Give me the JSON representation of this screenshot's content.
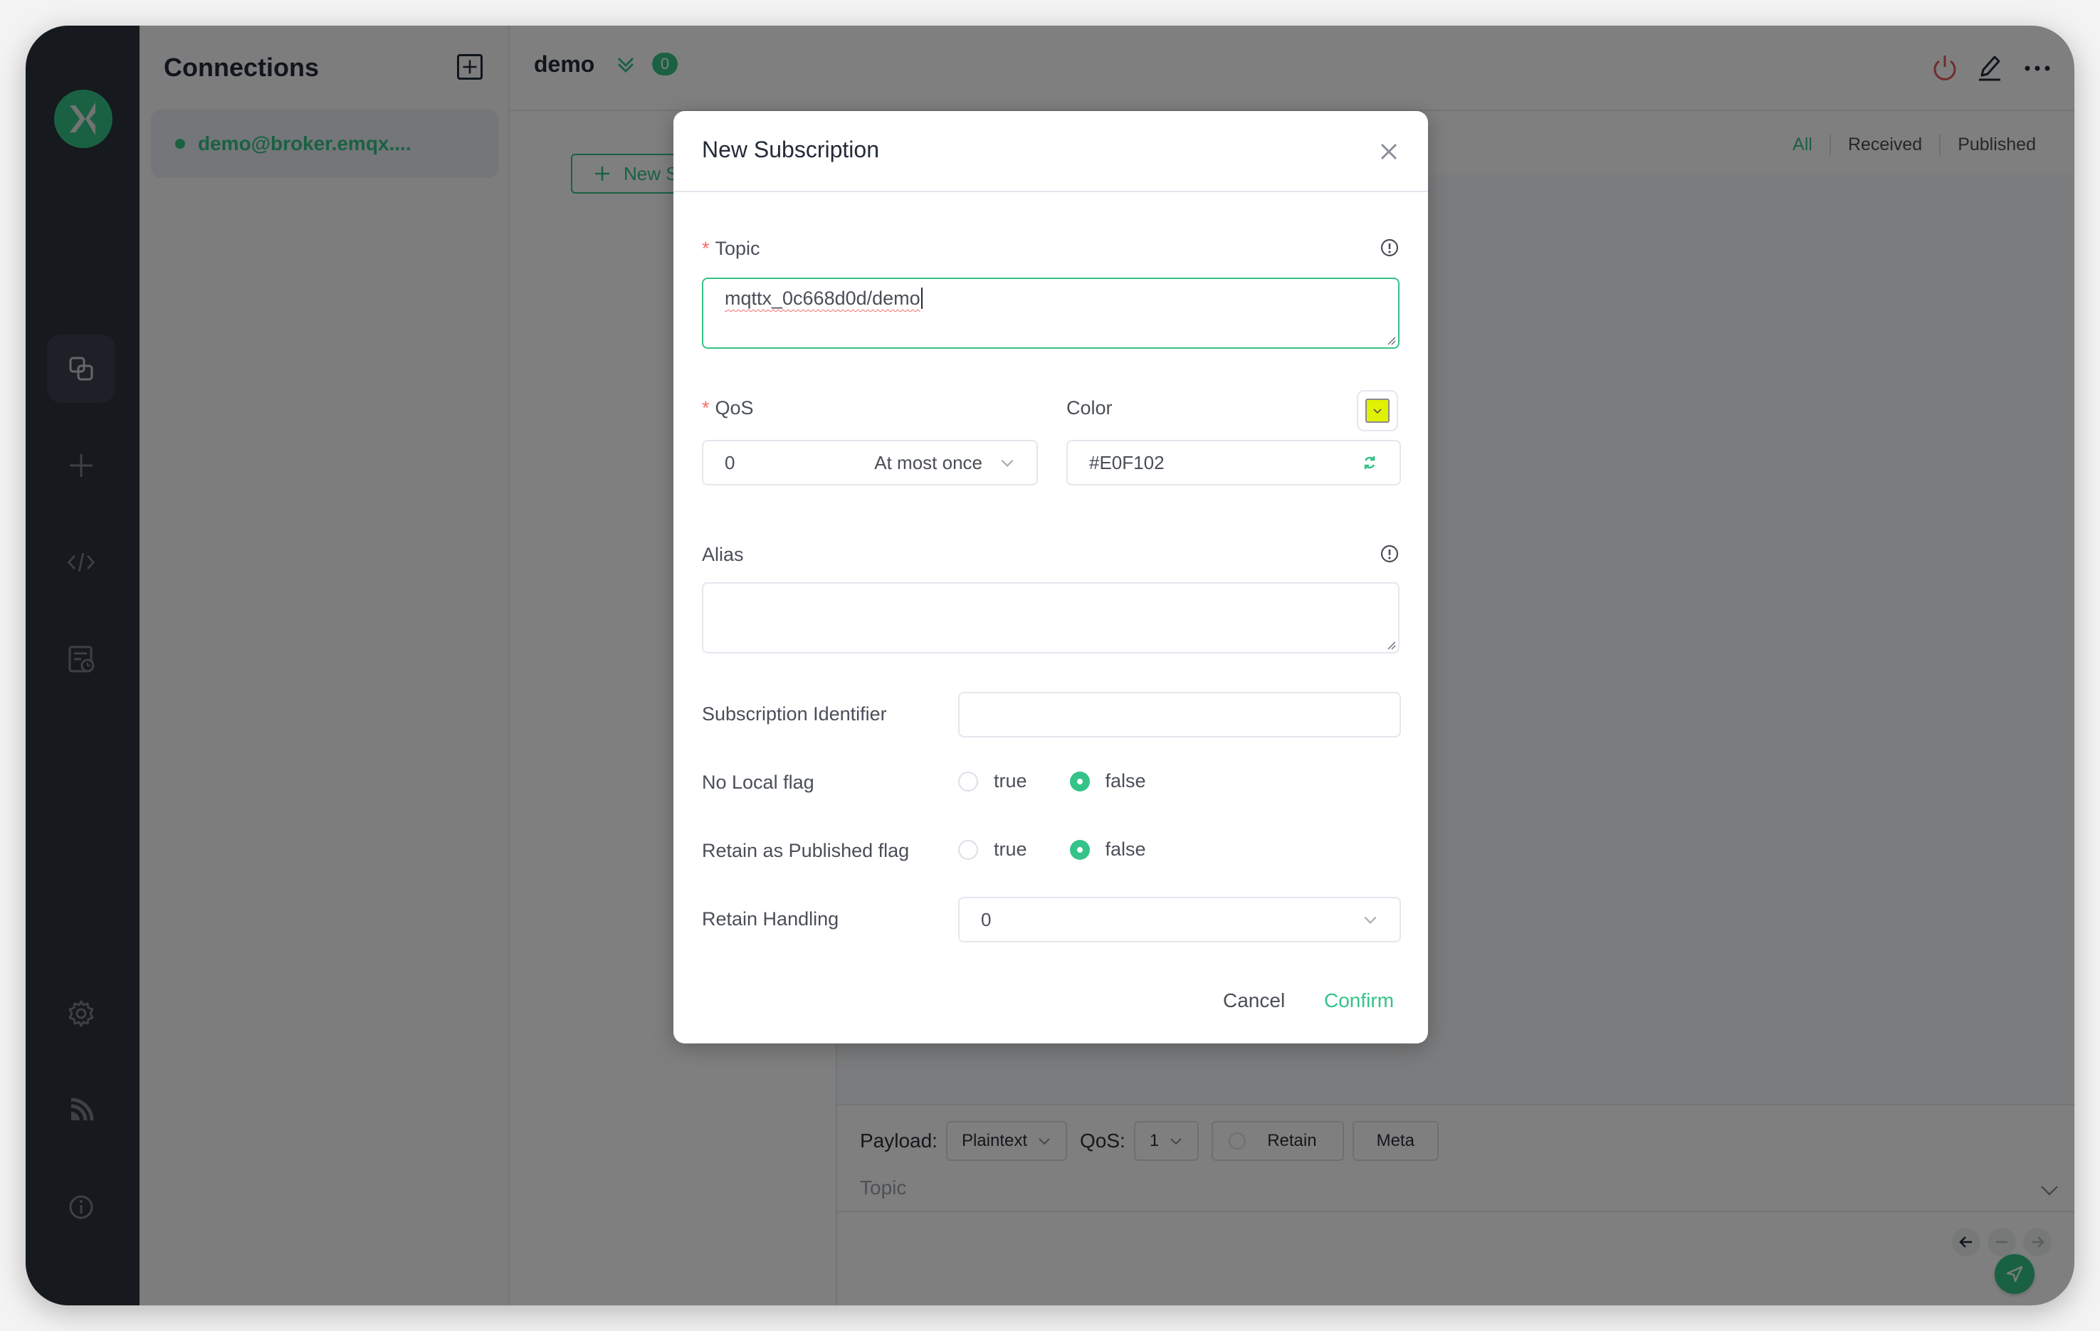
{
  "sidebar": {
    "items": [
      {
        "name": "connections",
        "icon": "connections-icon",
        "active": true
      },
      {
        "name": "new-connection",
        "icon": "plus-icon"
      },
      {
        "name": "script",
        "icon": "code-icon"
      },
      {
        "name": "log",
        "icon": "log-icon"
      },
      {
        "name": "settings",
        "icon": "gear-icon"
      },
      {
        "name": "feed",
        "icon": "rss-icon"
      },
      {
        "name": "about",
        "icon": "info-icon"
      }
    ]
  },
  "connections": {
    "title": "Connections",
    "items": [
      {
        "label": "demo@broker.emqx....",
        "status": "connected"
      }
    ]
  },
  "main": {
    "title": "demo",
    "unread_count": "0",
    "new_subscription_label": "New Subscription",
    "filters": [
      "All",
      "Received",
      "Published"
    ],
    "active_filter": "All"
  },
  "publish": {
    "payload_label": "Payload:",
    "payload_format": "Plaintext",
    "qos_label": "QoS:",
    "qos_value": "1",
    "retain_label": "Retain",
    "meta_label": "Meta",
    "topic_placeholder": "Topic"
  },
  "modal": {
    "title": "New Subscription",
    "topic": {
      "label": "Topic",
      "value": "mqttx_0c668d0d/demo",
      "required": true
    },
    "qos": {
      "label": "QoS",
      "value": "0",
      "description": "At most once",
      "required": true
    },
    "color": {
      "label": "Color",
      "value": "#E0F102"
    },
    "alias": {
      "label": "Alias",
      "value": ""
    },
    "subscription_identifier": {
      "label": "Subscription Identifier",
      "value": ""
    },
    "no_local": {
      "label": "No Local flag",
      "options": [
        "true",
        "false"
      ],
      "selected": "false"
    },
    "retain_as_published": {
      "label": "Retain as Published flag",
      "options": [
        "true",
        "false"
      ],
      "selected": "false"
    },
    "retain_handling": {
      "label": "Retain Handling",
      "value": "0"
    },
    "cancel_label": "Cancel",
    "confirm_label": "Confirm"
  },
  "colors": {
    "accent": "#34C388",
    "danger": "#F56C6C",
    "sidebar_bg": "#2C323B",
    "swatch": "#E0F102"
  }
}
